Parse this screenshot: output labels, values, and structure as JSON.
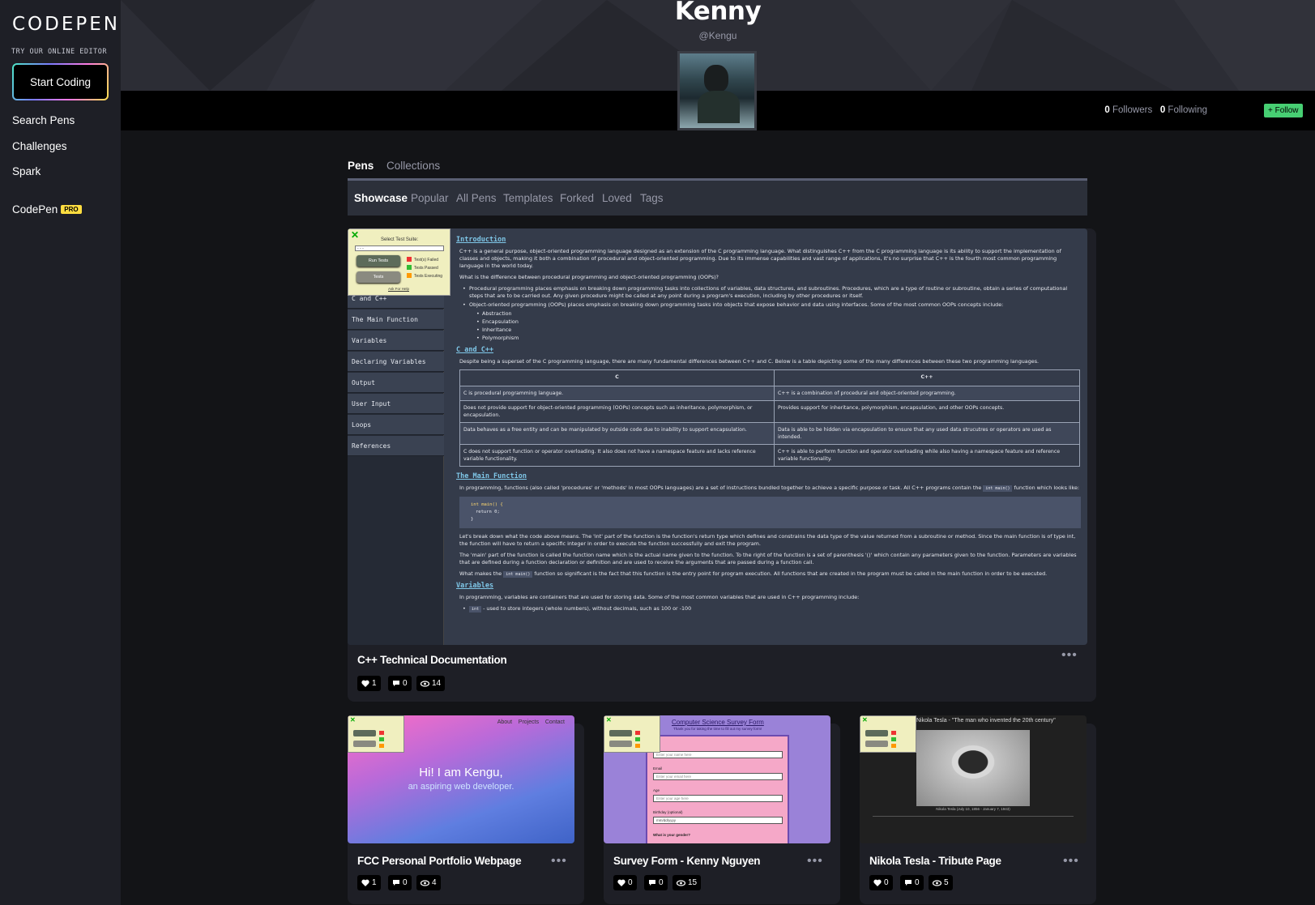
{
  "sidebar": {
    "logo": "CODEPEN",
    "try_label": "TRY OUR ONLINE EDITOR",
    "start_button": "Start Coding",
    "nav": [
      "Search Pens",
      "Challenges",
      "Spark"
    ],
    "codepen_label": "CodePen",
    "pro_badge": "PRO"
  },
  "profile": {
    "name": "Kenny",
    "handle": "@Kengu",
    "followers_count": "0",
    "followers_label": "Followers",
    "following_count": "0",
    "following_label": "Following",
    "follow_button": "+ Follow"
  },
  "tabs": {
    "pens": "Pens",
    "collections": "Collections"
  },
  "subtabs": [
    "Showcase",
    "Popular",
    "All Pens",
    "Templates",
    "Forked",
    "Loved",
    "Tags"
  ],
  "featured": {
    "title": "C++ Technical Documentation",
    "likes": "1",
    "comments": "0",
    "views": "14",
    "preview": {
      "nav": [
        "C and C++",
        "The Main Function",
        "Variables",
        "Declaring Variables",
        "Output",
        "User Input",
        "Loops",
        "References"
      ],
      "test_panel": {
        "close": "✕",
        "title": "Select Test Suite:",
        "select": "- - -",
        "run": "Run Tests",
        "tests": "Tests",
        "failed": "Test(s) Failed",
        "passed": "Tests Passed",
        "executing": "Tests Executing",
        "help": "Ask For Help"
      },
      "intro_heading": "Introduction",
      "intro_p1": "C++ is a general purpose, object-oriented programming language designed as an extension of the C programming language. What distinguishes C++ from the C programming language is its ability to support the implementation of classes and objects, making it both a combination of procedural and object-oriented programming. Due to its immense capabilities and vast range of applications, it's no surprise that C++ is the fourth most common programming language in the world today.",
      "intro_p2": "What is the difference between procedural programming and object-oriented programming (OOPs)?",
      "intro_li1": "Procedural programming places emphasis on breaking down programming tasks into collections of variables, data structures, and subroutines. Procedures, which are a type of routine or subroutine, obtain a series of computational steps that are to be carried out. Any given procedure might be called at any point during a program's execution, including by other procedures or itself.",
      "intro_li2": "Object-oriented programming (OOPs) places emphasis on breaking down programming tasks into objects that expose behavior and data using interfaces. Some of the most common OOPs concepts include:",
      "intro_sub": [
        "Abstraction",
        "Encapsulation",
        "Inheritance",
        "Polymorphism"
      ],
      "cc_heading": "C and C++",
      "cc_p": "Despite being a superset of the C programming language, there are many fundamental differences between C++ and C. Below is a table depicting some of the many differences between these two programming languages.",
      "table_head": [
        "C",
        "C++"
      ],
      "table_rows": [
        [
          "C is procedural programming language.",
          "C++ is a combination of procedural and object-oriented programming."
        ],
        [
          "Does not provide support for object-oriented programming (OOPs) concepts such as inheritance, polymorphism, or encapsulation.",
          "Provides support for inheritance, polymorphism, encapsulation, and other OOPs concepts."
        ],
        [
          "Data behaves as a free entity and can be manipulated by outside code due to inability to support encapsulation.",
          "Data is able to be hidden via encapsulation to ensure that any used data strucutres or operators are used as intended."
        ],
        [
          "C does not support function or operator overloading. It also does not have a namespace feature and lacks reference variable functionality.",
          "C++ is able to perform function and operator overloading while also having a namespace feature and reference variable functionality."
        ]
      ],
      "main_heading": "The Main Function",
      "main_p1": "In programming, functions (also called 'procedures' or 'methods' in most OOPs languages) are a set of instructions bundled together to achieve a specific purpose or task. All C++ programs contain the",
      "main_inline": "int main()",
      "main_p1_end": "function which looks like:",
      "code_lines": [
        "int main() {",
        "  return 0;",
        "}"
      ],
      "main_p2": "Let's break down what the code above means. The 'int' part of the function is the function's return type which defines and constrains the data type of the value returned from a subroutine or method. Since the main function is of type int, the function will have to return a specific integer in order to execute the function successfully and exit the program.",
      "main_p3": "The 'main' part of the function is called the function name which is the actual name given to the function. To the right of the function is a set of parenthesis '()' which contain any parameters given to the function. Parameters are variables that are defined during a function declaration or definition and are used to receive the arguments that are passed during a function call.",
      "main_p4a": "What makes the",
      "main_p4b": "function so significant is the fact that this function is the entry point for program execution. All functions that are created in the program must be called in the main function in order to be executed.",
      "var_heading": "Variables",
      "var_p": "In programming, variables are containers that are used for storing data. Some of the most common variables that are used in C++ programming include:",
      "var_inline": "int",
      "var_li1": "- used to store integers (whole numbers), without decimals, such as 100 or -100"
    }
  },
  "pens": [
    {
      "title": "FCC Personal Portfolio Webpage",
      "likes": "1",
      "comments": "0",
      "views": "4",
      "preview": {
        "nav": [
          "About",
          "Projects",
          "Contact"
        ],
        "hello": "Hi! I am Kengu,",
        "sub": "an aspiring web developer."
      }
    },
    {
      "title": "Survey Form - Kenny Nguyen",
      "likes": "0",
      "comments": "0",
      "views": "15",
      "preview": {
        "heading": "Computer Science Survey Form",
        "sub": "Thank you for taking the time to fill out my survey form!",
        "name_ph": "Enter your name here",
        "email_label": "Email",
        "email_ph": "Enter your email here",
        "age_label": "Age",
        "age_ph": "Enter your age here",
        "bday_label": "Birthday (optional)",
        "bday_ph": "mm/dd/yyyy",
        "gender_label": "What is your gender?"
      }
    },
    {
      "title": "Nikola Tesla - Tribute Page",
      "likes": "0",
      "comments": "0",
      "views": "5",
      "preview": {
        "quote": "Nikola Tesla - \"The man who invented the 20th century\"",
        "caption": "Nikola Tesla (July 10, 1856 - January 7, 1943)"
      }
    }
  ],
  "colors": {
    "accent_green": "#47cf73",
    "pro_yellow": "#ffdd40",
    "link_blue": "#7fc7e8"
  }
}
